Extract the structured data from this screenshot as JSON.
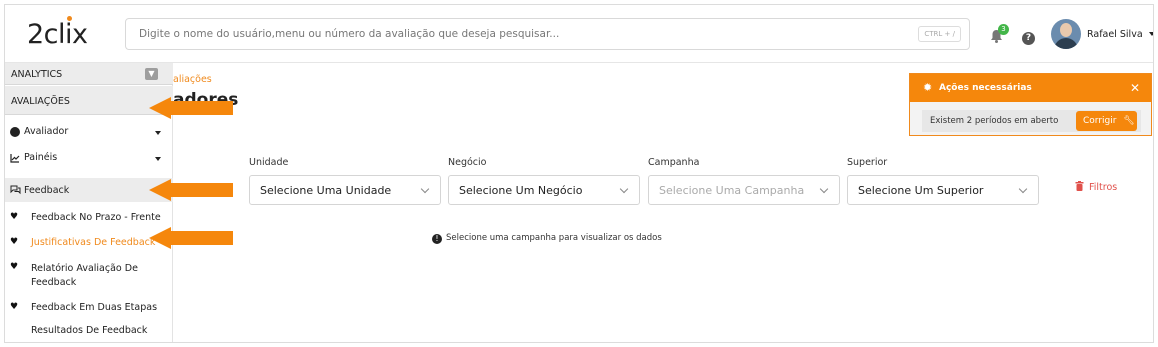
{
  "header": {
    "logo": "2clix",
    "search_placeholder": "Digite o nome do usuário,menu ou número da avaliação que deseja pesquisar...",
    "shortcut": "CTRL + /",
    "notification_count": "3",
    "help": "?",
    "user_name": "Rafael Silva"
  },
  "sidebar": {
    "analytics": "ANALYTICS",
    "avaliacoes": "AVALIAÇÕES",
    "avaliador": "Avaliador",
    "paineis": "Painéis",
    "feedback": "Feedback",
    "items": [
      "Feedback No Prazo - Frente",
      "Justificativas De Feedback",
      "Relatório Avaliação De Feedback",
      "Feedback Em Duas Etapas",
      "Resultados De Feedback"
    ]
  },
  "main": {
    "breadcrumb": "aliações",
    "page_title": "adores",
    "filters": {
      "unidade_label": "Unidade",
      "unidade_value": "Selecione Uma Unidade",
      "negocio_label": "Negócio",
      "negocio_value": "Selecione Um Negócio",
      "campanha_label": "Campanha",
      "campanha_value": "Selecione Uma Campanha",
      "superior_label": "Superior",
      "superior_value": "Selecione Um Superior",
      "filters_button": "Filtros"
    },
    "info_message": "Selecione uma campanha para visualizar os dados"
  },
  "notification": {
    "title": "Ações necessárias",
    "message": "Existem 2 períodos em aberto",
    "fix_button": "Corrigir"
  },
  "colors": {
    "accent": "#f5870c",
    "danger": "#e0514b"
  }
}
